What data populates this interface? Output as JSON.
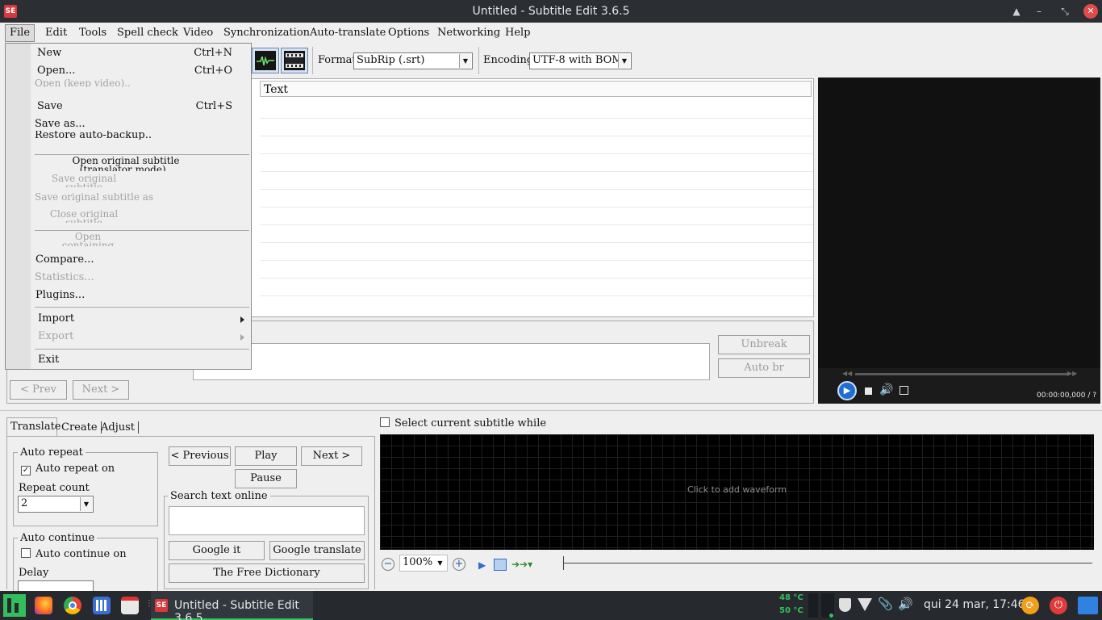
{
  "window": {
    "title": "Untitled - Subtitle Edit 3.6.5",
    "logo": "SE"
  },
  "menubar": [
    "File",
    "Edit",
    "Tools",
    "Spell check",
    "Video",
    "Synchronization",
    "Auto-translate",
    "Options",
    "Networking",
    "Help"
  ],
  "toolbar": {
    "format_label": "Format",
    "format_value": "SubRip (.srt)",
    "encoding_label": "Encoding",
    "encoding_value": "UTF-8 with BOM"
  },
  "grid": {
    "text_header": "Text"
  },
  "file_menu": {
    "new": "New",
    "new_sc": "Ctrl+N",
    "open": "Open...",
    "open_sc": "Ctrl+O",
    "open_keep_video": "Open (keep video)..",
    "save": "Save",
    "save_sc": "Ctrl+S",
    "save_as": "Save as...",
    "restore": "Restore auto-backup..",
    "open_original": "Open original subtitle (translator mode)..",
    "save_original": "Save original subtitle",
    "save_original_as": "Save original subtitle as",
    "close_original": "Close original subtitle",
    "open_folder": "Open containing folder",
    "compare": "Compare...",
    "statistics": "Statistics...",
    "plugins": "Plugins...",
    "import": "Import",
    "export": "Export",
    "exit": "Exit"
  },
  "edit": {
    "unbreak": "Unbreak",
    "auto_br": "Auto br",
    "prev": "< Prev",
    "next": "Next >"
  },
  "video": {
    "time": "00:00:00,000 / ?"
  },
  "tabs": {
    "translate": "Translate",
    "create": "Create",
    "adjust": "Adjust"
  },
  "translate": {
    "auto_repeat_group": "Auto repeat",
    "auto_repeat_on": "Auto repeat on",
    "repeat_count_label": "Repeat count",
    "repeat_count": "2",
    "auto_continue_group": "Auto continue",
    "auto_continue_on": "Auto continue on",
    "delay_label": "Delay",
    "previous": "< Previous",
    "play": "Play",
    "next": "Next >",
    "pause": "Pause",
    "search_group": "Search text online",
    "google_it": "Google it",
    "google_translate": "Google translate",
    "free_dictionary": "The Free Dictionary"
  },
  "waveform": {
    "select_current": "Select current subtitle while",
    "click_to_add": "Click to add waveform",
    "zoom": "100%"
  },
  "taskbar": {
    "active_app": "Untitled - Subtitle Edit 3.6.5",
    "temp1": "48 °C",
    "temp2": "50 °C",
    "clock": "qui 24 mar, 17:46"
  },
  "colors": {
    "titlebar": "#2b2e33",
    "close": "#e04b4b",
    "taskbar": "#262a2f",
    "accent_green": "#35bf5c"
  }
}
